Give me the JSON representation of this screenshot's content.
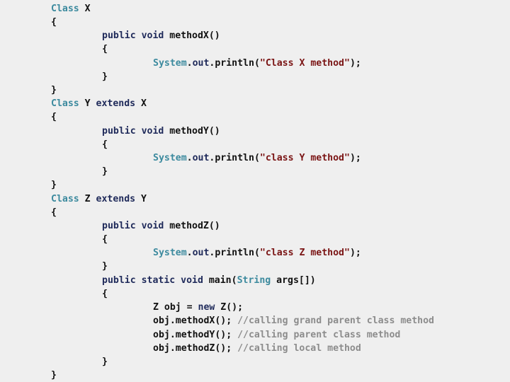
{
  "code": {
    "lines": [
      {
        "indent": 0,
        "tokens": [
          {
            "t": "Class",
            "c": "type"
          },
          {
            "t": " X",
            "c": "plain"
          }
        ]
      },
      {
        "indent": 0,
        "tokens": [
          {
            "t": "{",
            "c": "plain"
          }
        ]
      },
      {
        "indent": 1,
        "tokens": [
          {
            "t": "public void",
            "c": "kw"
          },
          {
            "t": " methodX()",
            "c": "plain"
          }
        ]
      },
      {
        "indent": 1,
        "tokens": [
          {
            "t": "{",
            "c": "plain"
          }
        ]
      },
      {
        "indent": 2,
        "tokens": [
          {
            "t": "System",
            "c": "type"
          },
          {
            "t": ".",
            "c": "plain"
          },
          {
            "t": "out",
            "c": "kw"
          },
          {
            "t": ".println(",
            "c": "plain"
          },
          {
            "t": "\"Class X method\"",
            "c": "str"
          },
          {
            "t": ");",
            "c": "plain"
          }
        ]
      },
      {
        "indent": 1,
        "tokens": [
          {
            "t": "}",
            "c": "plain"
          }
        ]
      },
      {
        "indent": 0,
        "tokens": [
          {
            "t": "}",
            "c": "plain"
          }
        ]
      },
      {
        "indent": 0,
        "tokens": [
          {
            "t": "Class",
            "c": "type"
          },
          {
            "t": " Y ",
            "c": "plain"
          },
          {
            "t": "extends",
            "c": "kw"
          },
          {
            "t": " X",
            "c": "plain"
          }
        ]
      },
      {
        "indent": 0,
        "tokens": [
          {
            "t": "{",
            "c": "plain"
          }
        ]
      },
      {
        "indent": 1,
        "tokens": [
          {
            "t": "public void",
            "c": "kw"
          },
          {
            "t": " methodY()",
            "c": "plain"
          }
        ]
      },
      {
        "indent": 1,
        "tokens": [
          {
            "t": "{",
            "c": "plain"
          }
        ]
      },
      {
        "indent": 2,
        "tokens": [
          {
            "t": "System",
            "c": "type"
          },
          {
            "t": ".",
            "c": "plain"
          },
          {
            "t": "out",
            "c": "kw"
          },
          {
            "t": ".println(",
            "c": "plain"
          },
          {
            "t": "\"class Y method\"",
            "c": "str"
          },
          {
            "t": ");",
            "c": "plain"
          }
        ]
      },
      {
        "indent": 1,
        "tokens": [
          {
            "t": "}",
            "c": "plain"
          }
        ]
      },
      {
        "indent": 0,
        "tokens": [
          {
            "t": "}",
            "c": "plain"
          }
        ]
      },
      {
        "indent": 0,
        "tokens": [
          {
            "t": "Class",
            "c": "type"
          },
          {
            "t": " Z ",
            "c": "plain"
          },
          {
            "t": "extends",
            "c": "kw"
          },
          {
            "t": " Y",
            "c": "plain"
          }
        ]
      },
      {
        "indent": 0,
        "tokens": [
          {
            "t": "{",
            "c": "plain"
          }
        ]
      },
      {
        "indent": 1,
        "tokens": [
          {
            "t": "public void",
            "c": "kw"
          },
          {
            "t": " methodZ()",
            "c": "plain"
          }
        ]
      },
      {
        "indent": 1,
        "tokens": [
          {
            "t": "{",
            "c": "plain"
          }
        ]
      },
      {
        "indent": 2,
        "tokens": [
          {
            "t": "System",
            "c": "type"
          },
          {
            "t": ".",
            "c": "plain"
          },
          {
            "t": "out",
            "c": "kw"
          },
          {
            "t": ".println(",
            "c": "plain"
          },
          {
            "t": "\"class Z method\"",
            "c": "str"
          },
          {
            "t": ");",
            "c": "plain"
          }
        ]
      },
      {
        "indent": 1,
        "tokens": [
          {
            "t": "}",
            "c": "plain"
          }
        ]
      },
      {
        "indent": 1,
        "tokens": [
          {
            "t": "public static void",
            "c": "kw"
          },
          {
            "t": " main(",
            "c": "plain"
          },
          {
            "t": "String",
            "c": "type"
          },
          {
            "t": " args[])",
            "c": "plain"
          }
        ]
      },
      {
        "indent": 1,
        "tokens": [
          {
            "t": "{",
            "c": "plain"
          }
        ]
      },
      {
        "indent": 2,
        "tokens": [
          {
            "t": "Z obj = ",
            "c": "plain"
          },
          {
            "t": "new",
            "c": "kw"
          },
          {
            "t": " Z();",
            "c": "plain"
          }
        ]
      },
      {
        "indent": 2,
        "tokens": [
          {
            "t": "obj.methodX(); ",
            "c": "plain"
          },
          {
            "t": "//calling grand parent class method",
            "c": "cm"
          }
        ]
      },
      {
        "indent": 2,
        "tokens": [
          {
            "t": "obj.methodY(); ",
            "c": "plain"
          },
          {
            "t": "//calling parent class method",
            "c": "cm"
          }
        ]
      },
      {
        "indent": 2,
        "tokens": [
          {
            "t": "obj.methodZ(); ",
            "c": "plain"
          },
          {
            "t": "//calling local method",
            "c": "cm"
          }
        ]
      },
      {
        "indent": 1,
        "tokens": [
          {
            "t": "}",
            "c": "plain"
          }
        ]
      },
      {
        "indent": 0,
        "tokens": [
          {
            "t": "}",
            "c": "plain"
          }
        ]
      }
    ]
  }
}
